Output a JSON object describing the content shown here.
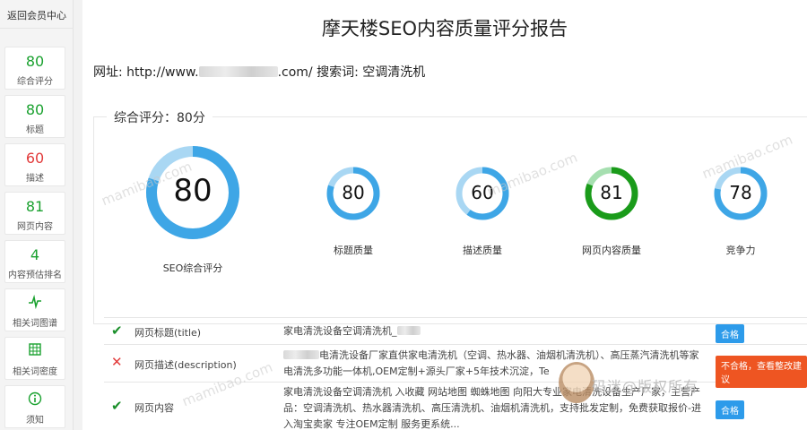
{
  "sidebar": {
    "back_label": "返回会员中心",
    "items": [
      {
        "value": "80",
        "label": "综合评分",
        "color": "#1aa12f"
      },
      {
        "value": "80",
        "label": "标题",
        "color": "#1aa12f"
      },
      {
        "value": "60",
        "label": "描述",
        "color": "#e23b3b"
      },
      {
        "value": "81",
        "label": "网页内容",
        "color": "#1aa12f"
      },
      {
        "value": "4",
        "label": "内容预估排名",
        "color": "#1aa12f"
      },
      {
        "icon": "pulse-icon",
        "label": "相关词图谱"
      },
      {
        "icon": "grid-icon",
        "label": "相关词密度"
      },
      {
        "icon": "info-icon",
        "label": "须知"
      }
    ]
  },
  "header": {
    "title": "摩天楼SEO内容质量评分报告",
    "url_prefix": "网址: http://www.",
    "url_suffix": ".com/ 搜索词: 空调清洗机"
  },
  "score": {
    "legend": "综合评分：80分",
    "main": {
      "value": 80,
      "label": "SEO综合评分"
    },
    "subs": [
      {
        "value": 80,
        "label": "标题质量"
      },
      {
        "value": 60,
        "label": "描述质量"
      },
      {
        "value": 81,
        "label": "网页内容质量",
        "highlight": true
      },
      {
        "value": 78,
        "label": "竞争力"
      }
    ],
    "colors": {
      "arc": "#3ea6e6",
      "track": "#a9d7f3",
      "green": "#1a9b1a",
      "green_track": "#a6dfb0"
    }
  },
  "rows": [
    {
      "status": "ok",
      "name": "网页标题(title)",
      "content": "家电清洗设备空调清洗机_",
      "badge": "合格",
      "badge_color": "#2d9bea"
    },
    {
      "status": "bad",
      "name": "网页描述(description)",
      "content": "电清洗设备厂家直供家电清洗机（空调、热水器、油烟机清洗机）、高压蒸汽清洗机等家电清洗多功能一体机,OEM定制+源头厂家+5年技术沉淀，Te",
      "badge": "不合格，查看整改建议",
      "badge_color": "#ee5522"
    },
    {
      "status": "ok",
      "name": "网页内容",
      "content": "家电清洗设备空调清洗机 入收藏 网站地图 蜘蛛地图 向阳大专业家电清洗设备生产厂家，主营产品：空调清洗机、热水器清洗机、高压清洗机、油烟机清洗机，支持批发定制，免费获取报价-进入淘宝卖家 专注OEM定制 服务更系统...",
      "badge": "合格",
      "badge_color": "#2d9bea"
    }
  ],
  "watermark": {
    "text": "mamibao.com",
    "stamp": "码迷@版权所有"
  }
}
